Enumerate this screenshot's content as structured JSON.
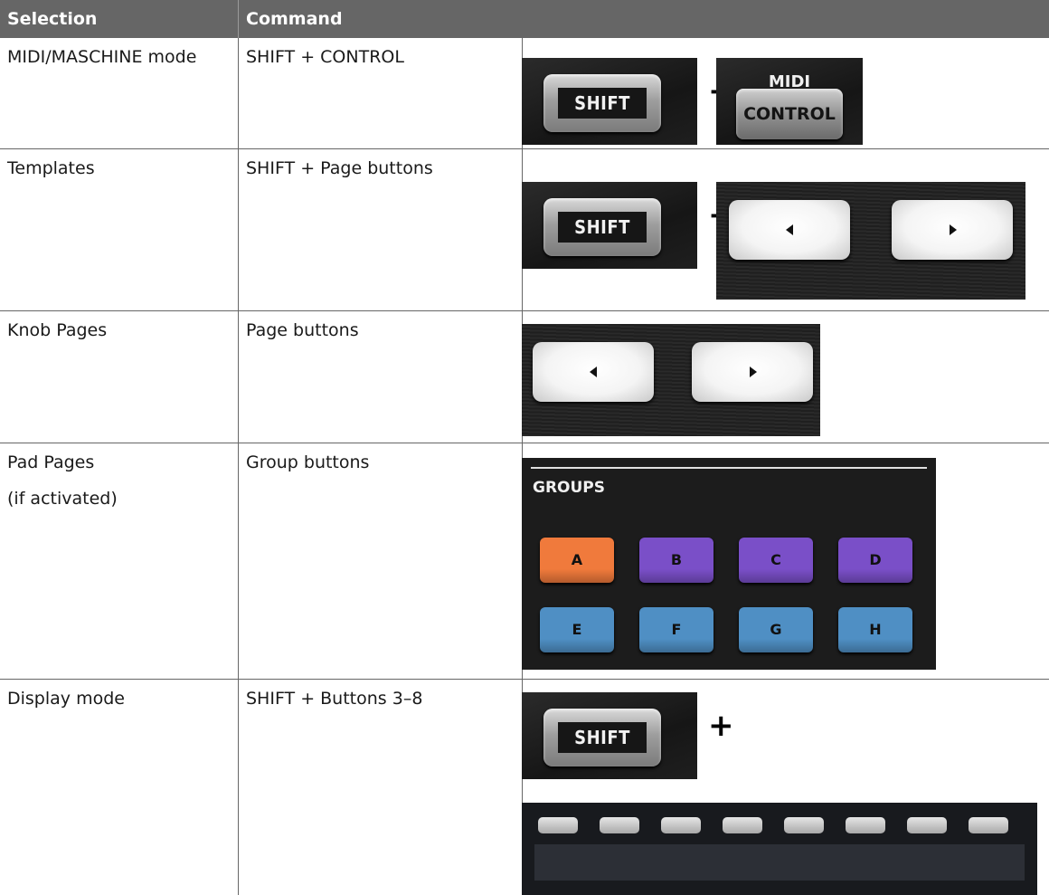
{
  "table": {
    "headers": {
      "selection": "Selection",
      "command": "Command"
    },
    "rows": [
      {
        "selection": "MIDI/MASCHINE mode",
        "selection_note": "",
        "command": "SHIFT + CONTROL"
      },
      {
        "selection": "Templates",
        "selection_note": "",
        "command": "SHIFT + Page buttons"
      },
      {
        "selection": "Knob Pages",
        "selection_note": "",
        "command": "Page buttons"
      },
      {
        "selection": "Pad Pages",
        "selection_note": "(if activated)",
        "command": "Group buttons"
      },
      {
        "selection": "Display mode",
        "selection_note": "",
        "command": "SHIFT + Buttons 3–8"
      }
    ]
  },
  "hardware": {
    "shift_label": "SHIFT",
    "plus": "+",
    "midi_label": "MIDI",
    "control_label": "CONTROL",
    "groups_label": "GROUPS",
    "group_pads": [
      {
        "label": "A",
        "color": "#f07a3c"
      },
      {
        "label": "B",
        "color": "#7a4fc8"
      },
      {
        "label": "C",
        "color": "#7a4fc8"
      },
      {
        "label": "D",
        "color": "#7a4fc8"
      },
      {
        "label": "E",
        "color": "#4f8fc4"
      },
      {
        "label": "F",
        "color": "#4f8fc4"
      },
      {
        "label": "G",
        "color": "#4f8fc4"
      },
      {
        "label": "H",
        "color": "#4f8fc4"
      }
    ]
  },
  "colors": {
    "header_bg": "#666666",
    "header_text": "#ffffff",
    "rule": "#666666"
  }
}
